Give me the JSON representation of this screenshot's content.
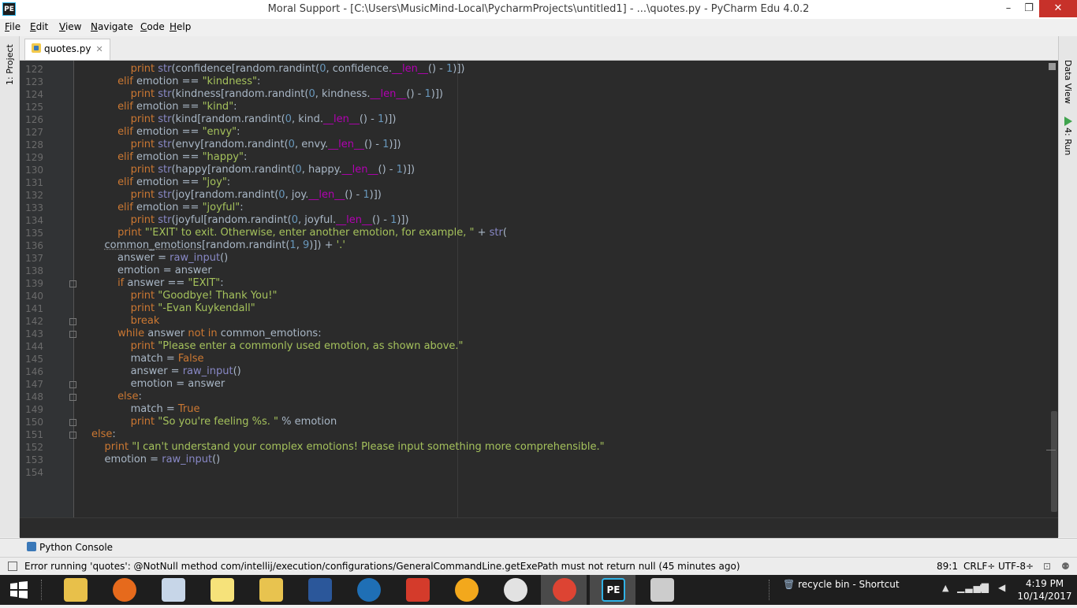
{
  "window": {
    "title": "Moral Support - [C:\\Users\\MusicMind-Local\\PycharmProjects\\untitled1] - ...\\quotes.py - PyCharm Edu 4.0.2",
    "app_icon_label": "PE",
    "minimize": "–",
    "maximize": "❐",
    "close": "✕"
  },
  "menu": [
    {
      "label": "File",
      "mn": "F",
      "rest": "ile"
    },
    {
      "label": "Edit",
      "mn": "E",
      "rest": "dit"
    },
    {
      "label": "View",
      "mn": "V",
      "rest": "iew"
    },
    {
      "label": "Navigate",
      "mn": "N",
      "rest": "avigate"
    },
    {
      "label": "Code",
      "mn": "C",
      "rest": "ode"
    },
    {
      "label": "Help",
      "mn": "H",
      "rest": "elp"
    }
  ],
  "tool_windows": {
    "left": "1: Project",
    "right_top": "Data View",
    "right_bottom": "4: Run"
  },
  "editor": {
    "file_tab": "quotes.py",
    "lines": [
      {
        "n": "122",
        "html": "            <span class='kw'>print</span> <span class='bi'>str</span>(confidence[random.randint(<span class='num'>0</span>, confidence.<span class='dnd'>__len__</span>() - <span class='num'>1</span>)])"
      },
      {
        "n": "123",
        "html": "        <span class='kw'>elif</span> emotion == <span class='str'>\"kindness\"</span>:"
      },
      {
        "n": "124",
        "html": "            <span class='kw'>print</span> <span class='bi'>str</span>(kindness[random.randint(<span class='num'>0</span>, kindness.<span class='dnd'>__len__</span>() - <span class='num'>1</span>)])"
      },
      {
        "n": "125",
        "html": "        <span class='kw'>elif</span> emotion == <span class='str'>\"kind\"</span>:"
      },
      {
        "n": "126",
        "html": "            <span class='kw'>print</span> <span class='bi'>str</span>(kind[random.randint(<span class='num'>0</span>, kind.<span class='dnd'>__len__</span>() - <span class='num'>1</span>)])"
      },
      {
        "n": "127",
        "html": "        <span class='kw'>elif</span> emotion == <span class='str'>\"envy\"</span>:"
      },
      {
        "n": "128",
        "html": "            <span class='kw'>print</span> <span class='bi'>str</span>(envy[random.randint(<span class='num'>0</span>, envy.<span class='dnd'>__len__</span>() - <span class='num'>1</span>)])"
      },
      {
        "n": "129",
        "html": "        <span class='kw'>elif</span> emotion == <span class='str'>\"happy\"</span>:"
      },
      {
        "n": "130",
        "html": "            <span class='kw'>print</span> <span class='bi'>str</span>(happy[random.randint(<span class='num'>0</span>, happy.<span class='dnd'>__len__</span>() - <span class='num'>1</span>)])"
      },
      {
        "n": "131",
        "html": "        <span class='kw'>elif</span> emotion == <span class='str'>\"joy\"</span>:"
      },
      {
        "n": "132",
        "html": "            <span class='kw'>print</span> <span class='bi'>str</span>(joy[random.randint(<span class='num'>0</span>, joy.<span class='dnd'>__len__</span>() - <span class='num'>1</span>)])"
      },
      {
        "n": "133",
        "html": "        <span class='kw'>elif</span> emotion == <span class='str'>\"joyful\"</span>:"
      },
      {
        "n": "134",
        "html": "            <span class='kw'>print</span> <span class='bi'>str</span>(joyful[random.randint(<span class='num'>0</span>, joyful.<span class='dnd'>__len__</span>() - <span class='num'>1</span>)])"
      },
      {
        "n": "135",
        "html": "        <span class='kw'>print</span> <span class='str'>\"'EXIT' to exit. Otherwise, enter another emotion, for example, \"</span> + <span class='bi'>str</span>("
      },
      {
        "n": "136",
        "html": "    <span style='text-decoration:underline dotted #888'>common_emotions</span>[random.randint(<span class='num'>1</span>, <span class='num'>9</span>)]) + <span class='str'>'.'</span>"
      },
      {
        "n": "137",
        "html": "        answer = <span class='bi'>raw_input</span>()"
      },
      {
        "n": "138",
        "html": "        emotion = answer"
      },
      {
        "n": "139",
        "html": "        <span class='kw'>if</span> answer == <span class='str'>\"EXIT\"</span>:"
      },
      {
        "n": "140",
        "html": "            <span class='kw'>print</span> <span class='str'>\"Goodbye! Thank You!\"</span>"
      },
      {
        "n": "141",
        "html": "            <span class='kw'>print</span> <span class='str'>\"-Evan Kuykendall\"</span>"
      },
      {
        "n": "142",
        "html": "            <span class='kw'>break</span>"
      },
      {
        "n": "143",
        "html": "        <span class='kw'>while</span> answer <span class='kw'>not in</span> common_emotions:"
      },
      {
        "n": "144",
        "html": "            <span class='kw'>print</span> <span class='str'>\"Please enter a commonly used emotion, as shown above.\"</span>"
      },
      {
        "n": "145",
        "html": "            match = <span class='kw'>False</span>"
      },
      {
        "n": "146",
        "html": "            answer = <span class='bi'>raw_input</span>()"
      },
      {
        "n": "147",
        "html": "            emotion = answer"
      },
      {
        "n": "148",
        "html": "        <span class='kw'>else</span>:"
      },
      {
        "n": "149",
        "html": "            match = <span class='kw'>True</span>"
      },
      {
        "n": "150",
        "html": "            <span class='kw'>print</span> <span class='str'>\"So you're feeling %s. \"</span> % emotion"
      },
      {
        "n": "151",
        "html": "<span class='kw'>else</span>:"
      },
      {
        "n": "152",
        "html": "    <span class='kw'>print</span> <span class='str'>\"I can't understand your complex emotions! Please input something more comprehensible.\"</span>"
      },
      {
        "n": "153",
        "html": "    emotion = <span class='bi'>raw_input</span>()"
      },
      {
        "n": "154",
        "html": ""
      }
    ]
  },
  "bottom": {
    "console_tab": "Python Console",
    "status_message": "Error running 'quotes': @NotNull method com/intellij/execution/configurations/GeneralCommandLine.getExePath must not return null (45 minutes ago)",
    "position": "89:1",
    "line_sep": "CRLF÷",
    "encoding": "UTF-8÷"
  },
  "taskbar": {
    "recycle_label": "recycle bin - Shortcut",
    "time": "4:19 PM",
    "date": "10/14/2017",
    "colors": {
      "explorer": "#e8c04a",
      "firefox": "#e66a1c",
      "calculator": "#c7d6e8",
      "notes": "#f6e27a",
      "folder": "#e8c34f",
      "word": "#2b579a",
      "fiddler": "#1f6fb5",
      "ccleaner": "#d43b2b",
      "aimp": "#f3a81c",
      "itunes": "#e2e2e2",
      "chrome": "#dd4433",
      "pycharm": "#1c1c1c",
      "snipping": "#cccccc"
    }
  }
}
